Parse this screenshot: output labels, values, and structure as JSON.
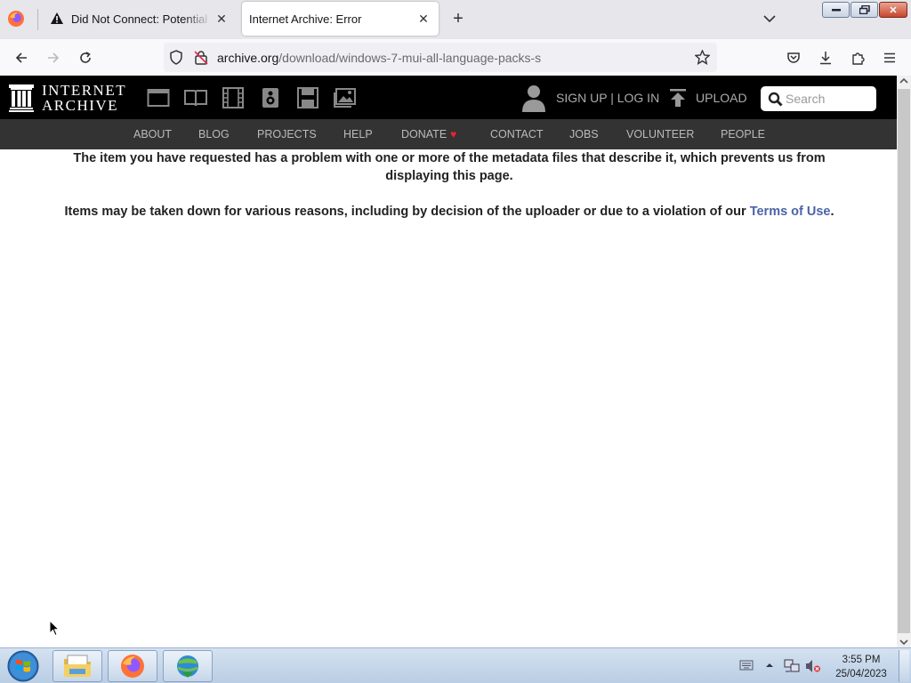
{
  "browser": {
    "tabs": [
      {
        "title": "Did Not Connect: Potential Security Issue",
        "active": false
      },
      {
        "title": "Internet Archive: Error",
        "active": true
      }
    ],
    "url_host": "archive.org",
    "url_path": "/download/windows-7-mui-all-language-packs-s"
  },
  "ia_header": {
    "logo_line1": "INTERNET",
    "logo_line2": "ARCHIVE",
    "media_icons": [
      "web-icon",
      "texts-icon",
      "video-icon",
      "audio-icon",
      "software-icon",
      "images-icon"
    ],
    "signup_login": "SIGN UP | LOG IN",
    "upload": "UPLOAD",
    "search_placeholder": "Search"
  },
  "ia_nav": [
    "ABOUT",
    "BLOG",
    "PROJECTS",
    "HELP",
    "DONATE",
    "CONTACT",
    "JOBS",
    "VOLUNTEER",
    "PEOPLE"
  ],
  "content": {
    "message1": "The item you have requested has a problem with one or more of the metadata files that describe it, which prevents us from displaying this page.",
    "message2_prefix": "Items may be taken down for various reasons, including by decision of the uploader or due to a violation of our ",
    "message2_link": "Terms of Use",
    "message2_suffix": "."
  },
  "taskbar": {
    "time": "3:55 PM",
    "date": "25/04/2023",
    "pinned": [
      "file-explorer-icon",
      "firefox-icon",
      "internet-download-manager-icon"
    ]
  },
  "colors": {
    "ia_header_bg": "#000000",
    "ia_nav_bg": "#333333",
    "link": "#4b64a7",
    "donate_heart": "#e22233"
  }
}
